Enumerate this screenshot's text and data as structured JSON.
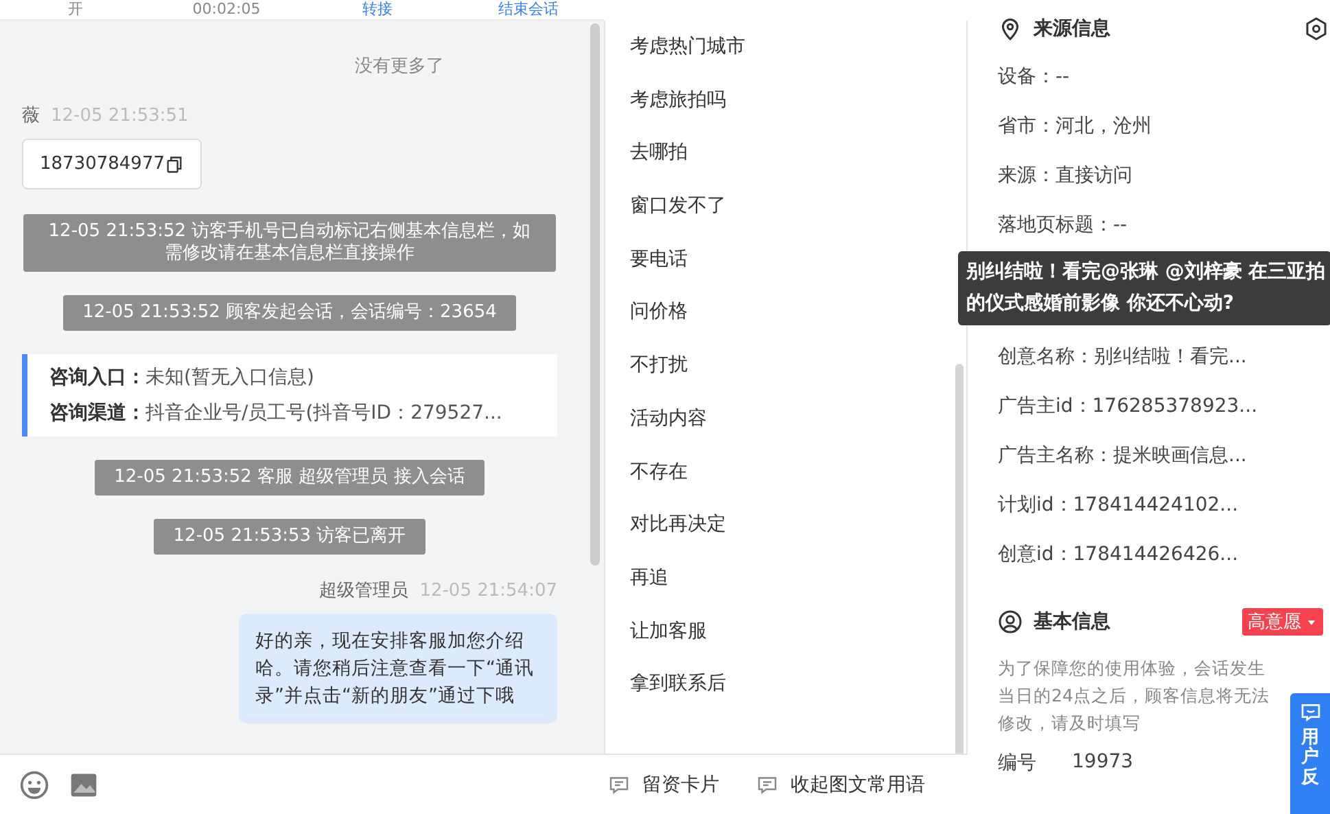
{
  "call_bar": {
    "label": "开",
    "duration": "00:02:05",
    "transfer": "转接",
    "end": "结束会话"
  },
  "chat": {
    "no_more": "没有更多了",
    "messages": [
      {
        "kind": "visitor",
        "name": "薇",
        "time": "12-05 21:53:51",
        "text": "18730784977"
      },
      {
        "kind": "system",
        "text": "12-05 21:53:52 访客手机号已自动标记右侧基本信息栏，如需修改请在基本信息栏直接操作"
      },
      {
        "kind": "system",
        "text": "12-05 21:53:52 顾客发起会话，会话编号：23654"
      },
      {
        "kind": "card",
        "rows": [
          {
            "label": "咨询入口：",
            "value": "未知(暂无入口信息)"
          },
          {
            "label": "咨询渠道：",
            "value": "抖音企业号/员工号(抖音号ID：279527..."
          }
        ]
      },
      {
        "kind": "system",
        "text": "12-05 21:53:52 客服 超级管理员 接入会话"
      },
      {
        "kind": "system",
        "text": "12-05 21:53:53 访客已离开"
      },
      {
        "kind": "agent",
        "name": "超级管理员",
        "time": "12-05 21:54:07",
        "text": "好的亲，现在安排客服加您介绍哈。请您稍后注意查看一下“通讯录”并点击“新的朋友”通过下哦"
      }
    ]
  },
  "phrases": [
    "考虑热门城市",
    "考虑旅拍吗",
    "去哪拍",
    "窗口发不了",
    "要电话",
    "问价格",
    "不打扰",
    "活动内容",
    "不存在",
    "对比再决定",
    "再追",
    "让加客服",
    "拿到联系后"
  ],
  "toolbar": [
    "留资卡片",
    "收起图文常用语"
  ],
  "source_info": {
    "title": "来源信息",
    "rows_before": [
      "设备：--",
      "省市：河北，沧州",
      "来源：直接访问",
      "落地页标题：--"
    ],
    "tooltip": "别纠结啦！看完@张琳 @刘梓豪 在三亚拍的仪式感婚前影像 你还不心动?",
    "rows_after": [
      "创意名称：别纠结啦！看完...",
      "广告主id：176285378923...",
      "广告主名称：提米映画信息...",
      "计划id：178414424102...",
      "创意id：178414426426..."
    ]
  },
  "basic_info": {
    "title": "基本信息",
    "intent": "高意愿",
    "note": "为了保障您的使用体验，会话发生当日的24点之后，顾客信息将无法修改，请及时填写",
    "fields": [
      {
        "label": "编号",
        "value": "19973"
      }
    ]
  },
  "feedback": "用户反"
}
